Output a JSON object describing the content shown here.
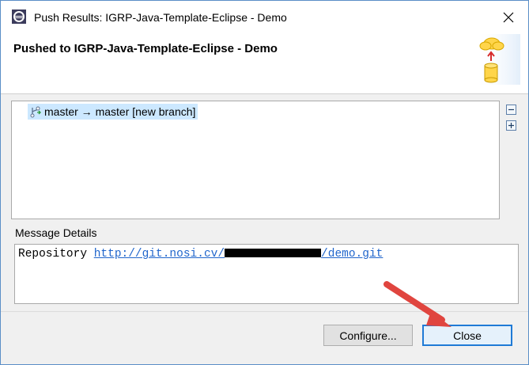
{
  "window": {
    "title": "Push Results: IGRP-Java-Template-Eclipse - Demo"
  },
  "header": {
    "title": "Pushed to IGRP-Java-Template-Eclipse - Demo"
  },
  "results": {
    "items": [
      {
        "label": "master → master [new branch]",
        "icon": "branch-push-icon",
        "selected": true
      }
    ]
  },
  "message_details": {
    "label": "Message Details",
    "prefix": "Repository ",
    "link_start": "http://git.nosi.cv/",
    "link_end": "/demo.git"
  },
  "buttons": {
    "configure": "Configure...",
    "close": "Close"
  },
  "colors": {
    "accent_border": "#1f7ad6",
    "selection": "#cce8ff",
    "link": "#2166cc",
    "annotation_arrow": "#e0453f"
  }
}
